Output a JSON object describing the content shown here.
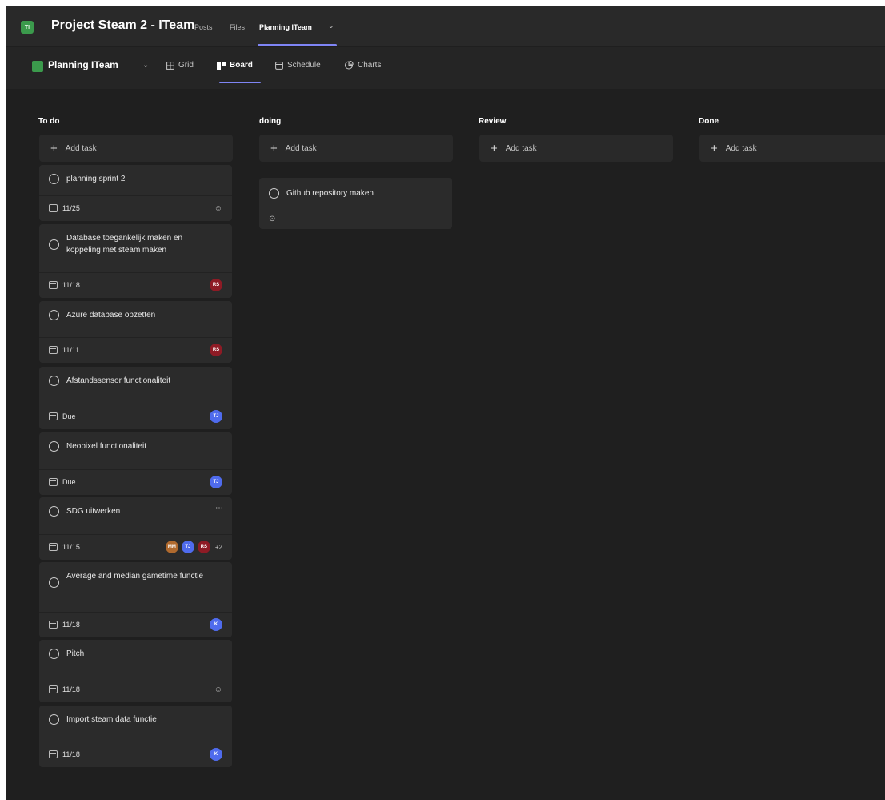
{
  "header": {
    "team_initials": "TI",
    "team_title": "Project Steam 2 - ITeam",
    "tabs": [
      {
        "label": "Posts"
      },
      {
        "label": "Files"
      },
      {
        "label": "Planning ITeam"
      }
    ],
    "active_tab": "Planning ITeam"
  },
  "planner": {
    "plan_name": "Planning ITeam",
    "views": [
      {
        "label": "Grid",
        "icon": "grid-icon"
      },
      {
        "label": "Board",
        "icon": "board-icon"
      },
      {
        "label": "Schedule",
        "icon": "schedule-icon"
      },
      {
        "label": "Charts",
        "icon": "charts-icon"
      }
    ],
    "active_view": "Board"
  },
  "board": {
    "add_task_label": "Add task",
    "columns": [
      {
        "title": "To do",
        "tasks": [
          {
            "title": "planning sprint 2",
            "due": "11/25",
            "assignees": [],
            "unassigned": true
          },
          {
            "title": "Database toegankelijk maken en koppeling met steam maken",
            "due": "11/18",
            "assignees": [
              {
                "initials": "RS",
                "color": "#8e1b25"
              }
            ]
          },
          {
            "title": "Azure database opzetten",
            "due": "11/11",
            "assignees": [
              {
                "initials": "RS",
                "color": "#8e1b25"
              }
            ]
          },
          {
            "title": "Afstandssensor functionaliteit",
            "due": "Due",
            "assignees": [
              {
                "initials": "TJ",
                "color": "#4f6bed"
              }
            ]
          },
          {
            "title": "Neopixel functionaliteit",
            "due": "Due",
            "assignees": [
              {
                "initials": "TJ",
                "color": "#4f6bed"
              }
            ]
          },
          {
            "title": "SDG uitwerken",
            "due": "11/15",
            "assignees": [
              {
                "initials": "MM",
                "color": "#b06a2e"
              },
              {
                "initials": "TJ",
                "color": "#4f6bed"
              },
              {
                "initials": "RS",
                "color": "#8e1b25"
              }
            ],
            "extra_assignees": "+2",
            "has_more_menu": true
          },
          {
            "title": "Average and median gametime functie",
            "due": "11/18",
            "assignees": [
              {
                "initials": "K",
                "color": "#4f6bed"
              }
            ]
          },
          {
            "title": "Pitch",
            "due": "11/18",
            "assignees": [],
            "unassigned": true
          },
          {
            "title": "Import steam data functie",
            "due": "11/18",
            "assignees": [
              {
                "initials": "K",
                "color": "#4f6bed"
              }
            ]
          }
        ]
      },
      {
        "title": "doing",
        "tasks": [
          {
            "title": "Github repository maken",
            "has_comment": true
          }
        ]
      },
      {
        "title": "Review",
        "tasks": []
      },
      {
        "title": "Done",
        "tasks": []
      }
    ]
  },
  "colors": {
    "accent": "#7f85f5",
    "background": "#1f1f1f",
    "card": "#2b2b2b",
    "team_tile": "#3b9a4c"
  }
}
